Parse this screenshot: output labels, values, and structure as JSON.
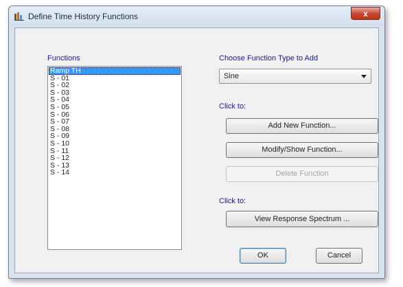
{
  "window": {
    "title": "Define Time History Functions",
    "close_label": "x"
  },
  "functions": {
    "label": "Functions",
    "items": [
      {
        "label": "Ramp TH",
        "selected": true
      },
      {
        "label": "S - 01"
      },
      {
        "label": "S - 02"
      },
      {
        "label": "S - 03"
      },
      {
        "label": "S - 04"
      },
      {
        "label": "S - 05"
      },
      {
        "label": "S - 06"
      },
      {
        "label": "S - 07"
      },
      {
        "label": "S - 08"
      },
      {
        "label": "S - 09"
      },
      {
        "label": "S - 10"
      },
      {
        "label": "S - 11"
      },
      {
        "label": "S - 12"
      },
      {
        "label": "S - 13"
      },
      {
        "label": "S - 14"
      }
    ]
  },
  "function_type": {
    "label": "Choose  Function Type to Add",
    "selected": "Sine"
  },
  "click_to_1": "Click to:",
  "buttons": {
    "add_new": "Add New Function...",
    "modify_show": "Modify/Show Function...",
    "delete": "Delete Function",
    "view_response": "View Response Spectrum ...",
    "ok": "OK",
    "cancel": "Cancel"
  },
  "click_to_2": "Click to:",
  "colors": {
    "selection": "#3399ff",
    "label_text": "#1a1a8c",
    "close_button": "#c9452e"
  }
}
